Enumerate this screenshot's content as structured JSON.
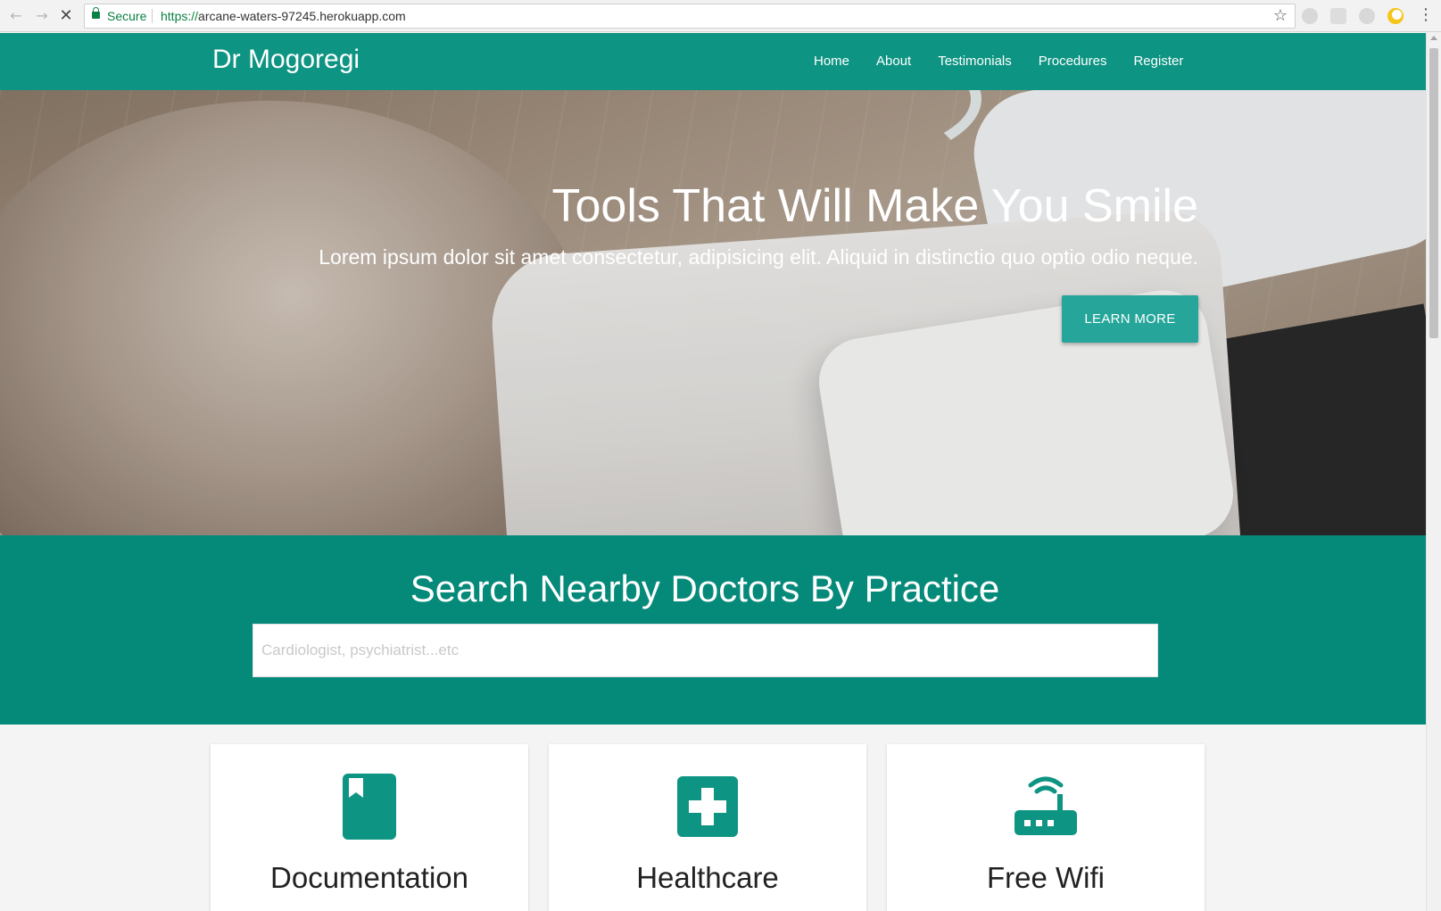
{
  "browser": {
    "secure_label": "Secure",
    "url_scheme": "https://",
    "url_host": "arcane-waters-97245.herokuapp.com",
    "back_icon": "arrow-left-icon",
    "forward_icon": "arrow-right-icon",
    "reload_icon": "close-icon",
    "star_icon": "star-icon",
    "menu_icon": "kebab-menu-icon"
  },
  "navbar": {
    "brand": "Dr Mogoregi",
    "links": [
      "Home",
      "About",
      "Testimonials",
      "Procedures",
      "Register"
    ],
    "bg_color": "#0e9483"
  },
  "hero": {
    "title": "Tools That Will Make You Smile",
    "subtitle": "Lorem ipsum dolor sit amet consectetur, adipisicing elit. Aliquid in distinctio quo optio odio neque.",
    "cta_label": "LEARN MORE",
    "cta_color": "#26a69a"
  },
  "search": {
    "title": "Search Nearby Doctors By Practice",
    "placeholder": "Cardiologist, psychiatrist...etc",
    "value": "",
    "bg_color": "#058a7a"
  },
  "features": [
    {
      "title": "Documentation",
      "icon": "book-icon"
    },
    {
      "title": "Healthcare",
      "icon": "medical-cross-icon"
    },
    {
      "title": "Free Wifi",
      "icon": "wifi-router-icon"
    }
  ],
  "accent_color": "#0e9483"
}
